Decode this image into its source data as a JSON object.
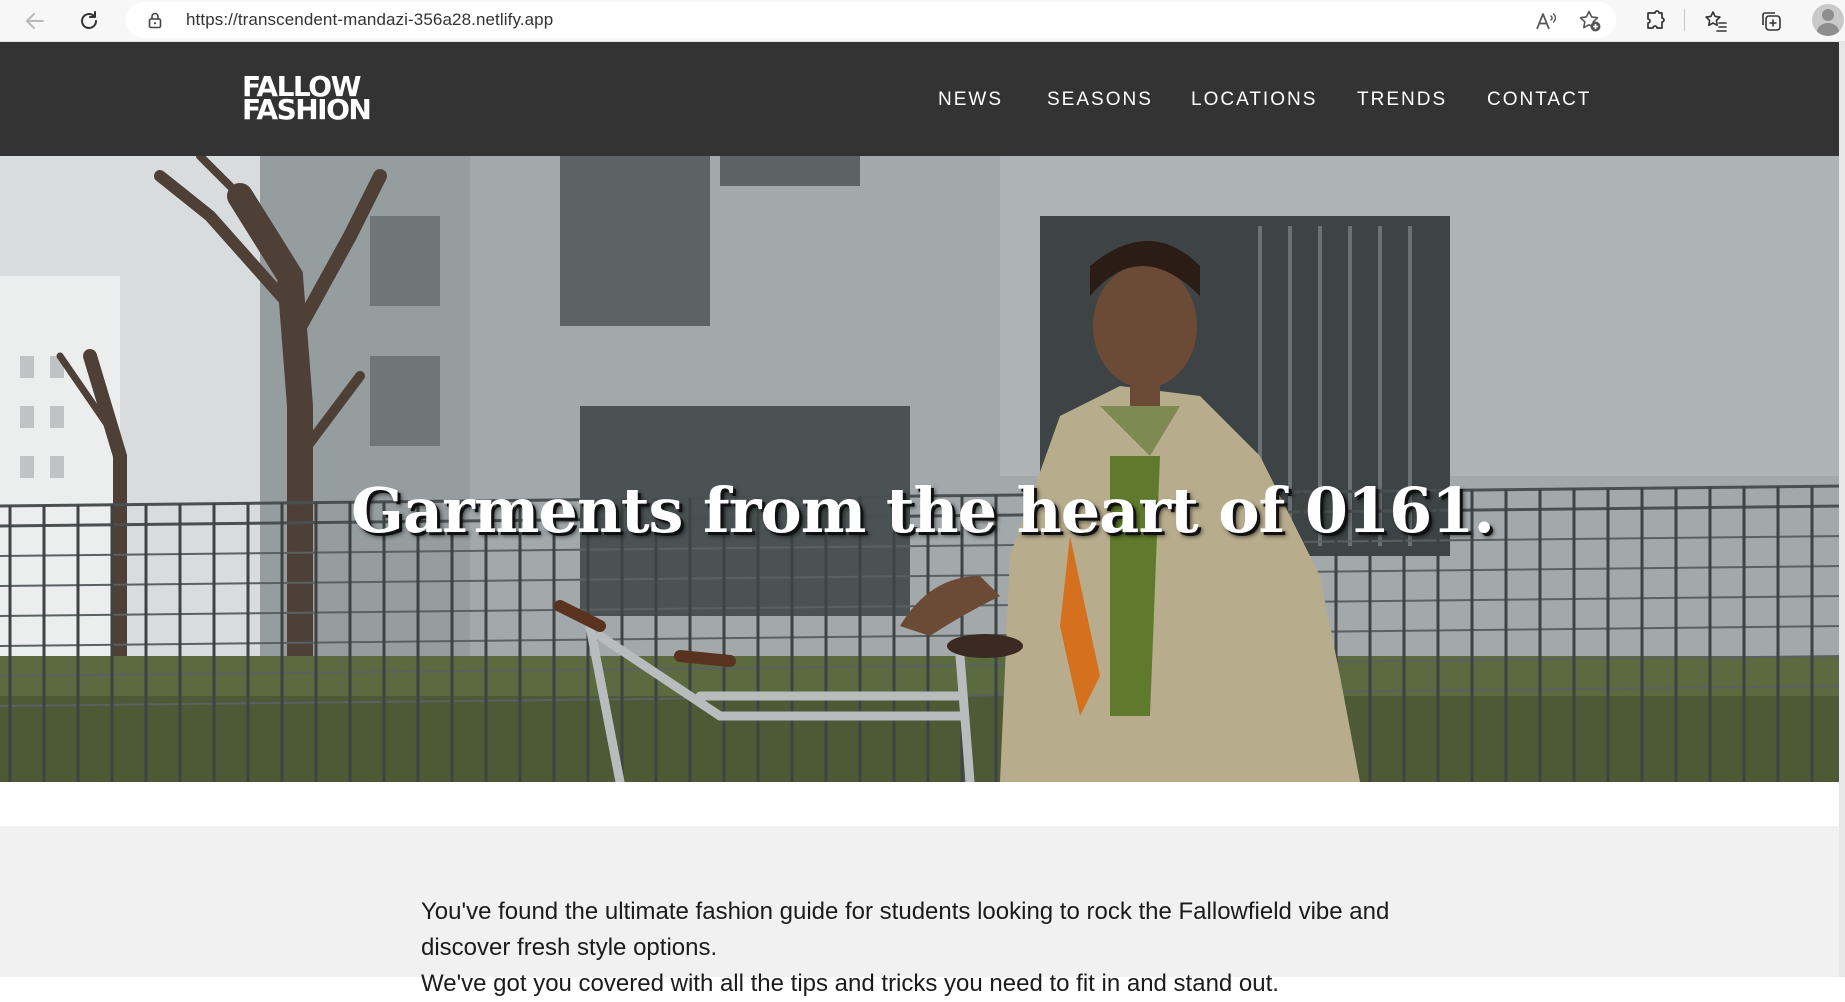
{
  "browser": {
    "url": "https://transcendent-mandazi-356a28.netlify.app"
  },
  "site": {
    "logo_line1": "FALLOW",
    "logo_line2": "FASHION",
    "nav": [
      {
        "label": "NEWS"
      },
      {
        "label": "SEASONS"
      },
      {
        "label": "LOCATIONS"
      },
      {
        "label": "TRENDS"
      },
      {
        "label": "CONTACT"
      }
    ],
    "colors": {
      "header_bg": "#333333",
      "intro_bg": "#f1f1f1"
    }
  },
  "hero": {
    "title": "Garments from the heart of 0161."
  },
  "intro": {
    "paragraph": "You've found the ultimate fashion guide for students looking to rock the Fallowfield vibe and discover fresh style options.",
    "next_line": "We've got you covered with all the tips and tricks you need to fit in and stand out."
  },
  "icons": [
    "back-icon",
    "refresh-icon",
    "lock-icon",
    "read-aloud-icon",
    "favorite-add-icon",
    "extensions-icon",
    "favorites-icon",
    "collections-icon",
    "profile-avatar"
  ]
}
